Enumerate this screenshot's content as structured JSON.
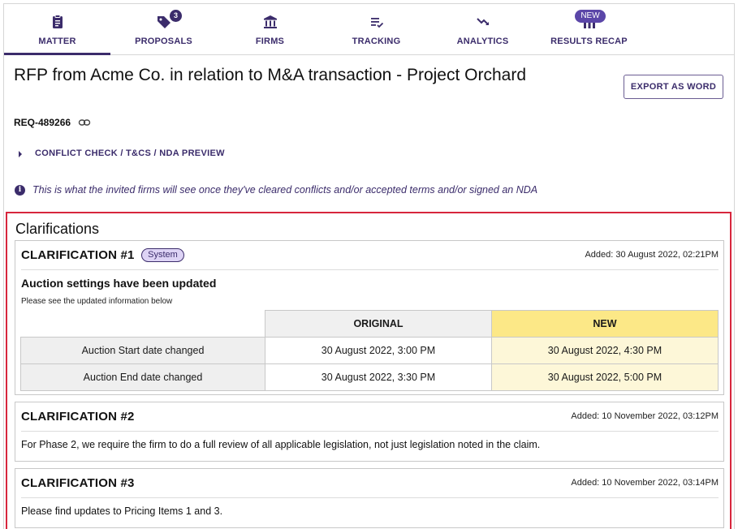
{
  "tabs": [
    {
      "label": "MATTER",
      "icon": "clipboard-icon",
      "active": true
    },
    {
      "label": "PROPOSALS",
      "icon": "tag-icon",
      "badge": "3"
    },
    {
      "label": "FIRMS",
      "icon": "bank-icon"
    },
    {
      "label": "TRACKING",
      "icon": "list-check-icon"
    },
    {
      "label": "ANALYTICS",
      "icon": "trend-down-icon"
    },
    {
      "label": "RESULTS RECAP",
      "icon": "bar-chart-icon",
      "badge": "NEW"
    }
  ],
  "header": {
    "title": "RFP from Acme Co. in relation to M&A transaction - Project Orchard",
    "export_label": "EXPORT AS WORD",
    "req_id": "REQ-489266"
  },
  "conflict_label": "CONFLICT CHECK / T&CS / NDA PREVIEW",
  "info_text": "This is what the invited firms will see once they've cleared conflicts and/or accepted terms and/or signed an NDA",
  "clarifications": {
    "heading": "Clarifications",
    "items": [
      {
        "title": "CLARIFICATION #1",
        "tag": "System",
        "added": "Added: 30 August 2022, 02:21PM",
        "subtitle": "Auction settings have been updated",
        "note": "Please see the updated information below",
        "table": {
          "headers": [
            "ORIGINAL",
            "NEW"
          ],
          "rows": [
            {
              "label": "Auction Start date changed",
              "original": "30 August 2022, 3:00 PM",
              "new": "30 August 2022, 4:30 PM"
            },
            {
              "label": "Auction End date changed",
              "original": "30 August 2022, 3:30 PM",
              "new": "30 August 2022, 5:00 PM"
            }
          ]
        }
      },
      {
        "title": "CLARIFICATION #2",
        "added": "Added: 10 November 2022, 03:12PM",
        "body": "For Phase 2, we require the firm to do a full review of all applicable legislation, not just legislation noted in the claim."
      },
      {
        "title": "CLARIFICATION #3",
        "added": "Added: 10 November 2022, 03:14PM",
        "body": "Please find updates to Pricing Items 1 and 3."
      }
    ]
  },
  "colors": {
    "brand": "#3b2c6b",
    "highlight_border": "#d7263d",
    "new_header": "#fce887",
    "new_cell": "#fdf7d8"
  }
}
